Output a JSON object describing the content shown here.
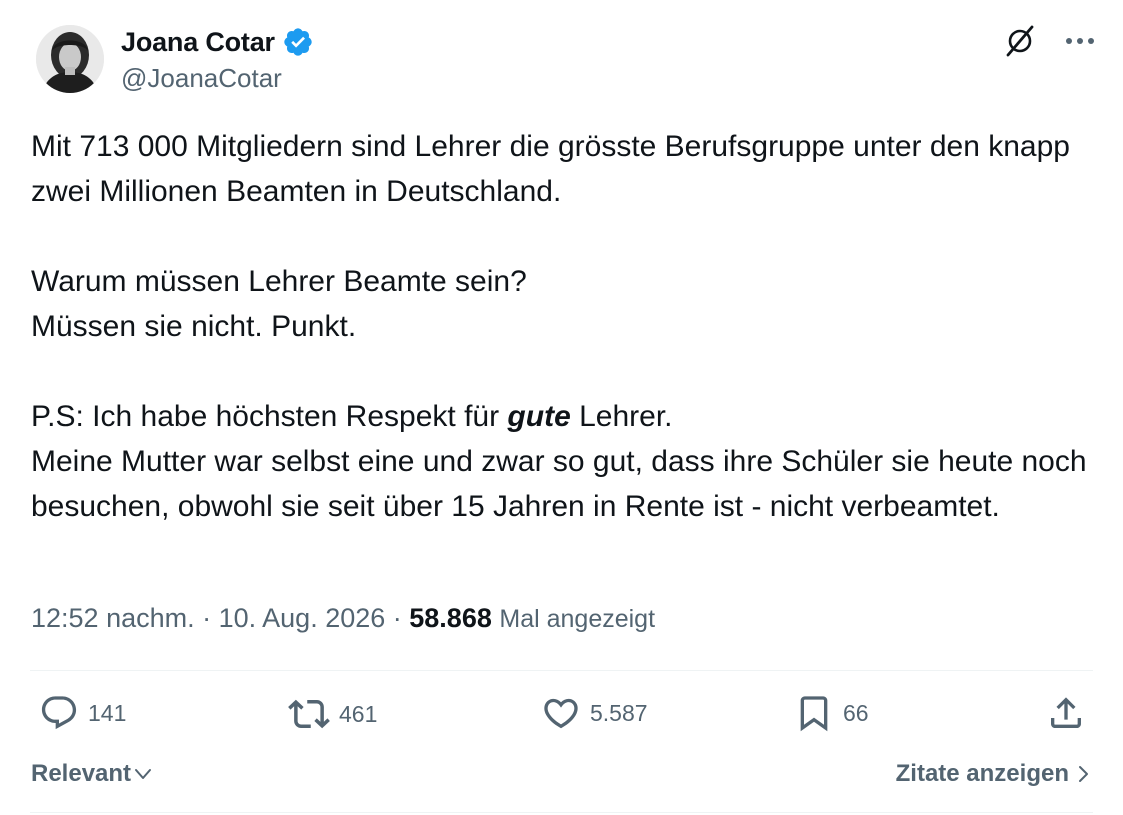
{
  "author": {
    "display_name": "Joana Cotar",
    "handle": "@JoanaCotar",
    "verified": true,
    "verified_color": "#1d9bf0"
  },
  "top_actions": {
    "grok_icon": "slash-circle-icon",
    "more_icon": "more-dots-icon"
  },
  "tweet": {
    "line1": "Mit 713 000 Mitgliedern sind Lehrer die grösste Berufsgruppe unter den knapp zwei Millionen Beamten in Deutschland.",
    "line2": "Warum müssen Lehrer Beamte sein?",
    "line3": "Müssen sie nicht. Punkt.",
    "ps_before": "P.S: Ich habe höchsten Respekt für ",
    "ps_emphasis": "gute",
    "ps_after": " Lehrer.",
    "line5": "Meine Mutter war selbst eine und zwar so gut, dass ihre Schüler sie heute noch besuchen, obwohl sie seit über 15 Jahren in Rente ist - nicht verbeamtet."
  },
  "meta": {
    "time": "12:52 nachm.",
    "sep1": " · ",
    "date": "10. Aug. 2026",
    "sep2": " · ",
    "views": "58.868",
    "views_label": "Mal angezeigt"
  },
  "actions": {
    "replies": "141",
    "reposts": "461",
    "likes": "5.587",
    "bookmarks": "66"
  },
  "footer": {
    "sort_label": "Relevant",
    "quotes_label": "Zitate anzeigen"
  },
  "colors": {
    "text": "#0f1419",
    "secondary": "#536471",
    "divider": "#eff3f4",
    "accent": "#1d9bf0"
  }
}
